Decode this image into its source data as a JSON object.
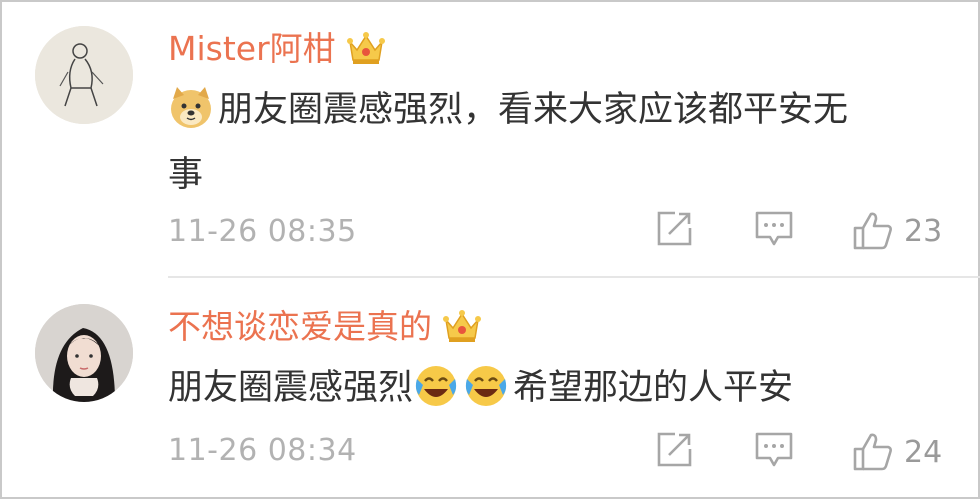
{
  "comments": [
    {
      "author": "Mister阿柑",
      "text_line1": "朋友圈震感强烈，看来大家应该都平安无",
      "text_line2": "事",
      "text_emoji": "doge-emoji",
      "time": "11-26 08:35",
      "likes": "23"
    },
    {
      "author": "不想谈恋爱是真的",
      "text_part1": "朋友圈震感强烈",
      "text_part2": "希望那边的人平安",
      "text_emojis": [
        "laugh-cry-emoji",
        "laugh-cry-emoji"
      ],
      "time": "11-26 08:34",
      "likes": "24"
    }
  ],
  "icons": {
    "author_badge": "crown-icon",
    "repost": "repost-icon",
    "comment": "comment-icon",
    "like": "thumbs-up-icon"
  },
  "colors": {
    "author_name": "#eb7350",
    "body_text": "#333333",
    "meta_text": "#b2b2b2",
    "crown_gold": "#f6c94a",
    "crown_red": "#e8553d"
  }
}
